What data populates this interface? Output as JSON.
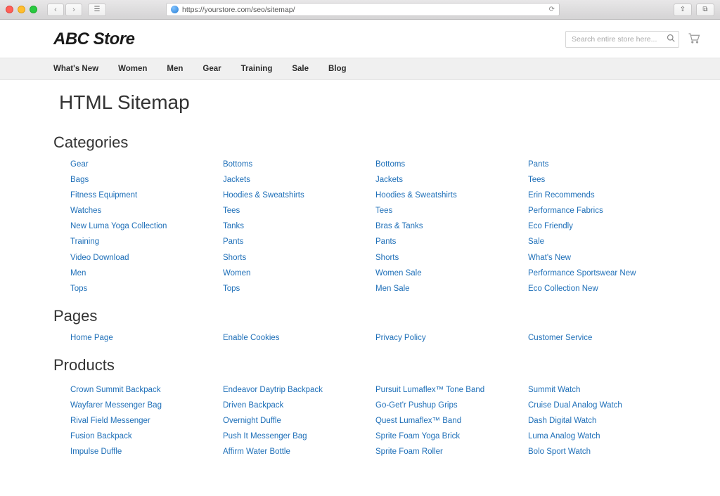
{
  "browser": {
    "url": "https://yourstore.com/seo/sitemap/"
  },
  "header": {
    "logo": "ABC Store",
    "search_placeholder": "Search entire store here..."
  },
  "nav": [
    "What's New",
    "Women",
    "Men",
    "Gear",
    "Training",
    "Sale",
    "Blog"
  ],
  "page_title": "HTML Sitemap",
  "sections": {
    "categories": {
      "title": "Categories",
      "cols": [
        [
          "Gear",
          "Bags",
          "Fitness Equipment",
          "Watches",
          "New Luma Yoga Collection",
          "Training",
          "Video Download",
          "Men",
          "Tops"
        ],
        [
          "Bottoms",
          "Jackets",
          "Hoodies & Sweatshirts",
          "Tees",
          "Tanks",
          "Pants",
          "Shorts",
          "Women",
          "Tops"
        ],
        [
          "Bottoms",
          "Jackets",
          "Hoodies & Sweatshirts",
          "Tees",
          "Bras & Tanks",
          "Pants",
          "Shorts",
          "Women Sale",
          "Men Sale"
        ],
        [
          "Pants",
          "Tees",
          "Erin Recommends",
          "Performance Fabrics",
          "Eco Friendly",
          "Sale",
          "What's New",
          "Performance Sportswear New",
          "Eco Collection New"
        ]
      ]
    },
    "pages": {
      "title": "Pages",
      "cols": [
        [
          "Home Page"
        ],
        [
          "Enable Cookies"
        ],
        [
          "Privacy Policy"
        ],
        [
          "Customer Service"
        ]
      ]
    },
    "products": {
      "title": "Products",
      "cols": [
        [
          "Crown Summit Backpack",
          "Wayfarer Messenger Bag",
          "Rival Field Messenger",
          "Fusion Backpack",
          "Impulse Duffle"
        ],
        [
          "Endeavor Daytrip Backpack",
          "Driven Backpack",
          "Overnight Duffle",
          "Push It Messenger Bag",
          "Affirm Water Bottle"
        ],
        [
          "Pursuit Lumaflex™ Tone Band",
          "Go-Get'r Pushup Grips",
          "Quest Lumaflex™ Band",
          "Sprite Foam Yoga Brick",
          "Sprite Foam Roller"
        ],
        [
          "Summit Watch",
          "Cruise Dual Analog Watch",
          "Dash Digital Watch",
          "Luma Analog Watch",
          "Bolo Sport Watch"
        ]
      ]
    }
  }
}
